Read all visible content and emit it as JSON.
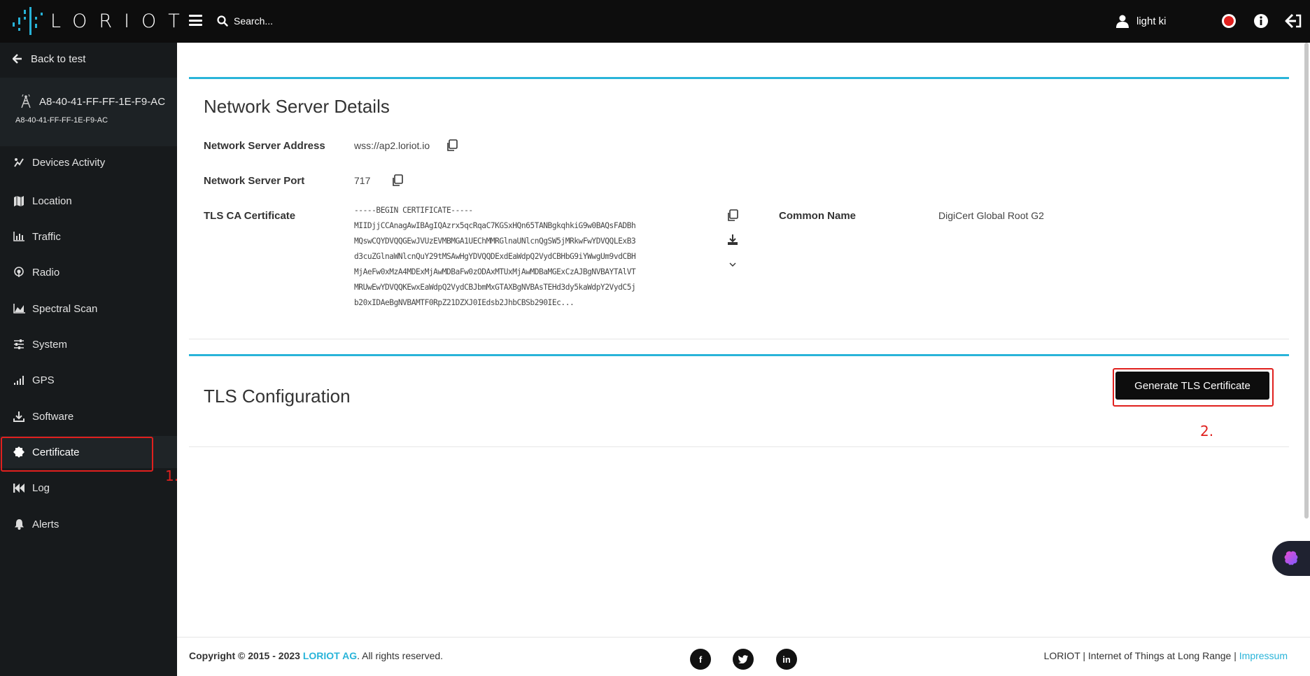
{
  "brand": {
    "name": "LORIOT",
    "accent": "#29b4d9"
  },
  "header": {
    "search_placeholder": "Search...",
    "user_name": "light ki"
  },
  "sidebar": {
    "back_label": "Back to test",
    "gateway": {
      "title": "A8-40-41-FF-FF-1E-F9-AC",
      "subtitle": "A8-40-41-FF-FF-1E-F9-AC"
    },
    "items": [
      {
        "label": "Devices Activity",
        "icon": "devices-activity-icon"
      },
      {
        "label": "Location",
        "icon": "map-icon"
      },
      {
        "label": "Traffic",
        "icon": "bar-chart-icon"
      },
      {
        "label": "Radio",
        "icon": "radio-icon"
      },
      {
        "label": "Spectral Scan",
        "icon": "area-chart-icon"
      },
      {
        "label": "System",
        "icon": "sliders-icon"
      },
      {
        "label": "GPS",
        "icon": "signal-bars-icon"
      },
      {
        "label": "Software",
        "icon": "download-icon"
      },
      {
        "label": "Certificate",
        "icon": "certificate-icon",
        "active": true
      },
      {
        "label": "Log",
        "icon": "backward-icon"
      },
      {
        "label": "Alerts",
        "icon": "bell-icon"
      }
    ]
  },
  "network": {
    "title": "Network Server Details",
    "address_label": "Network Server Address",
    "address_value": "wss://ap2.loriot.io",
    "port_label": "Network Server Port",
    "port_value": "717",
    "tls_label": "TLS CA Certificate",
    "cert_lines": [
      "-----BEGIN CERTIFICATE-----",
      "MIIDjjCCAnagAwIBAgIQAzrx5qcRqaC7KGSxHQn65TANBgkqhkiG9w0BAQsFADBh",
      "MQswCQYDVQQGEwJVUzEVMBMGA1UEChMMRGlnaUNlcnQgSW5jMRkwFwYDVQQLExB3",
      "d3cuZGlnaWNlcnQuY29tMSAwHgYDVQQDExdEaWdpQ2VydCBHbG9iYWwgUm9vdCBH",
      "MjAeFw0xMzA4MDExMjAwMDBaFw0zODAxMTUxMjAwMDBaMGExCzAJBgNVBAYTAlVT",
      "MRUwEwYDVQQKEwxEaWdpQ2VydCBJbmMxGTAXBgNVBAsTEHd3dy5kaWdpY2VydC5j",
      "b20xIDAeBgNVBAMTF0RpZ21DZXJ0IEdsb2JhbCBSb290IEc..."
    ],
    "common_name_label": "Common Name",
    "common_name_value": "DigiCert Global Root G2"
  },
  "tls": {
    "title": "TLS Configuration",
    "generate_label": "Generate TLS Certificate"
  },
  "annotations": {
    "step1": "1.",
    "step2": "2."
  },
  "footer": {
    "copyright_prefix": "Copyright © 2015 - 2023",
    "company": "LORIOT AG",
    "rights": ". All rights reserved.",
    "tagline": "LORIOT | Internet of Things at Long Range |",
    "impressum": "Impressum",
    "social": [
      "facebook",
      "twitter",
      "linkedin"
    ]
  }
}
